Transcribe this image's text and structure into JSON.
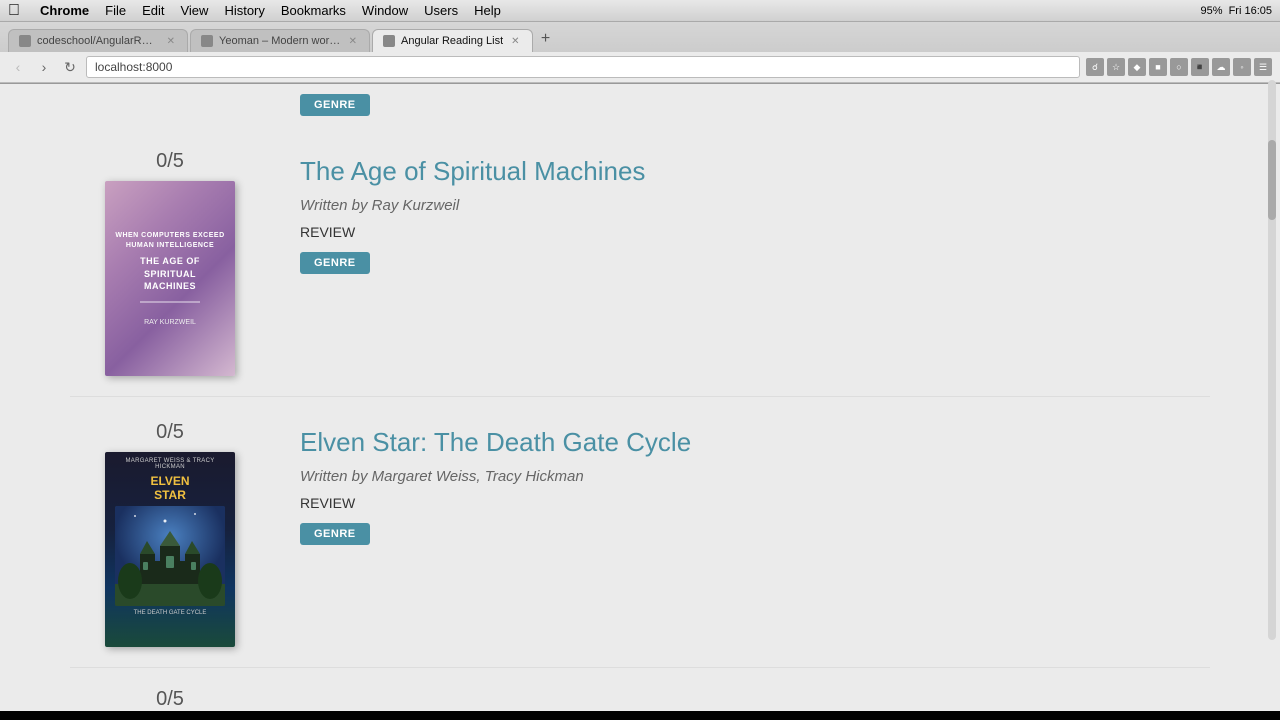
{
  "menubar": {
    "apple_symbol": "🍎",
    "items": [
      "Chrome",
      "File",
      "Edit",
      "View",
      "History",
      "Bookmarks",
      "Window",
      "Users",
      "Help"
    ],
    "time": "Fri 16:05",
    "battery": "95%"
  },
  "browser": {
    "tabs": [
      {
        "id": "tab1",
        "label": "codeschool/AngularReadi...",
        "active": false,
        "closeable": true
      },
      {
        "id": "tab2",
        "label": "Yeoman – Modern workflo...",
        "active": false,
        "closeable": true
      },
      {
        "id": "tab3",
        "label": "Angular Reading List",
        "active": true,
        "closeable": true
      }
    ],
    "address": "localhost:8000"
  },
  "books": [
    {
      "id": "book-top-partial",
      "rating": "",
      "genre_button": "GENRE",
      "partial": true,
      "top_only": true
    },
    {
      "id": "book1",
      "rating": "0/5",
      "title": "The Age of Spiritual Machines",
      "author": "Written by Ray Kurzweil",
      "review_label": "REVIEW",
      "genre_button": "GENRE",
      "cover_type": "spiritual-machines",
      "cover_lines": [
        "When Computers Exceed",
        "Human Intelligence",
        "",
        "THE AGE OF",
        "SPIRITUAL",
        "MACHINES",
        "",
        "RAY KURZWEIL"
      ]
    },
    {
      "id": "book2",
      "rating": "0/5",
      "title": "Elven Star: The Death Gate Cycle",
      "author": "Written by Margaret Weiss, Tracy Hickman",
      "review_label": "REVIEW",
      "genre_button": "GENRE",
      "cover_type": "elven-star",
      "cover_lines": [
        "Margaret Weiss & Tracy Hickman",
        "ELVEN STAR"
      ]
    },
    {
      "id": "book3",
      "rating": "0/5",
      "partial": true,
      "bottom_only": true
    }
  ]
}
